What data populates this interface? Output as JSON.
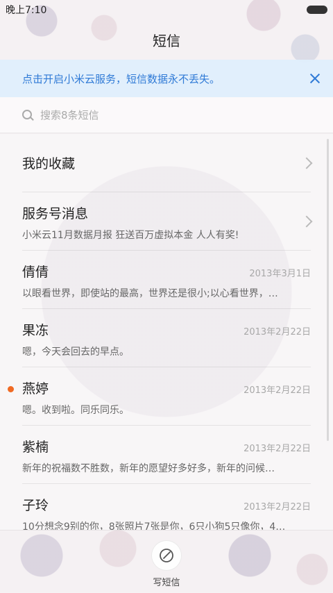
{
  "status_bar": {
    "time": "晚上7:10"
  },
  "header": {
    "title": "短信"
  },
  "banner": {
    "text": "点击开启小米云服务，短信数据永不丢失。"
  },
  "search": {
    "placeholder": "搜索8条短信"
  },
  "favorites": {
    "label": "我的收藏"
  },
  "service": {
    "label": "服务号消息",
    "preview": "小米云11月数据月报 狂送百万虚拟本金 人人有奖!"
  },
  "messages": [
    {
      "name": "倩倩",
      "date": "2013年3月1日",
      "preview": "以眼看世界，即使站的最高，世界还是很小;以心看世界，…",
      "unread": false
    },
    {
      "name": "果冻",
      "date": "2013年2月22日",
      "preview": "嗯，今天会回去的早点。",
      "unread": false
    },
    {
      "name": "燕婷",
      "date": "2013年2月22日",
      "preview": "嗯。收到啦。同乐同乐。",
      "unread": true
    },
    {
      "name": "紫楠",
      "date": "2013年2月22日",
      "preview": "新年的祝福数不胜数，新年的愿望好多好多，新年的问候…",
      "unread": false
    },
    {
      "name": "子玲",
      "date": "2013年2月22日",
      "preview": "10分想念9别的你，8张照片7张是你，6只小狗5只像你，4…",
      "unread": false
    }
  ],
  "compose": {
    "label": "写短信",
    "icon": "compose-icon"
  },
  "colors": {
    "accent": "#2f7ad6",
    "unread": "#f06a23"
  }
}
